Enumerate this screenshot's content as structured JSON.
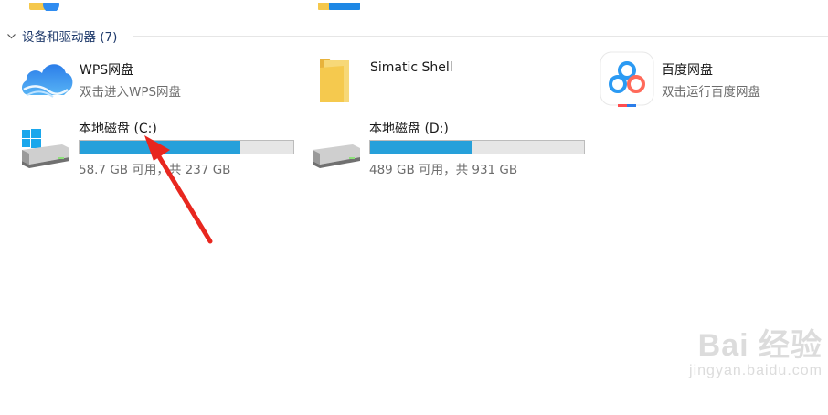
{
  "group": {
    "title": "设备和驱动器 (7)"
  },
  "items": {
    "wps": {
      "name": "WPS网盘",
      "desc": "双击进入WPS网盘"
    },
    "simatic": {
      "name": "Simatic Shell"
    },
    "baidu": {
      "name": "百度网盘",
      "desc": "双击运行百度网盘"
    }
  },
  "drives": [
    {
      "name": "本地磁盘 (C:)",
      "usage": "58.7 GB 可用，共 237 GB",
      "used_fraction": 0.752
    },
    {
      "name": "本地磁盘 (D:)",
      "usage": "489 GB 可用，共 931 GB",
      "used_fraction": 0.475
    }
  ],
  "watermark": {
    "brand": "Bai 经验",
    "url": "jingyan.baidu.com"
  },
  "colors": {
    "bar_fill": "#26a0da",
    "bar_track": "#e6e6e6",
    "arrow": "#e8271f",
    "header_text": "#1f3a6b"
  }
}
